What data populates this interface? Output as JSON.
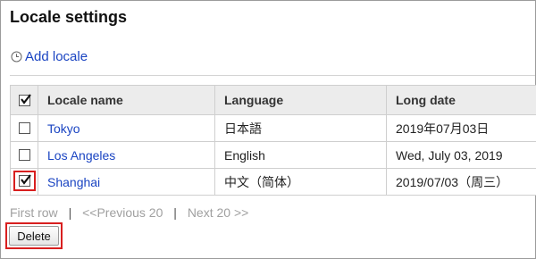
{
  "page": {
    "title": "Locale settings"
  },
  "actions": {
    "add_locale": "Add locale"
  },
  "table": {
    "headers": {
      "select_all": "",
      "name": "Locale name",
      "language": "Language",
      "long_date": "Long date"
    },
    "select_all_checked": true,
    "rows": [
      {
        "name": "Tokyo",
        "language": "日本語",
        "long_date": "2019年07月03日",
        "checked": false
      },
      {
        "name": "Los Angeles",
        "language": "English",
        "long_date": "Wed, July 03, 2019",
        "checked": false
      },
      {
        "name": "Shanghai",
        "language": "中文（简体）",
        "long_date": "2019/07/03（周三）",
        "checked": true
      }
    ]
  },
  "pager": {
    "first": "First row",
    "prev": "<<Previous 20",
    "next": "Next 20 >>",
    "separator": "|"
  },
  "buttons": {
    "delete": "Delete"
  },
  "colors": {
    "link": "#1a44c2",
    "highlight": "#d81f1f",
    "header_bg": "#ececec"
  },
  "icons": {
    "add": "clock-plus-icon",
    "check": "checkmark-icon"
  }
}
